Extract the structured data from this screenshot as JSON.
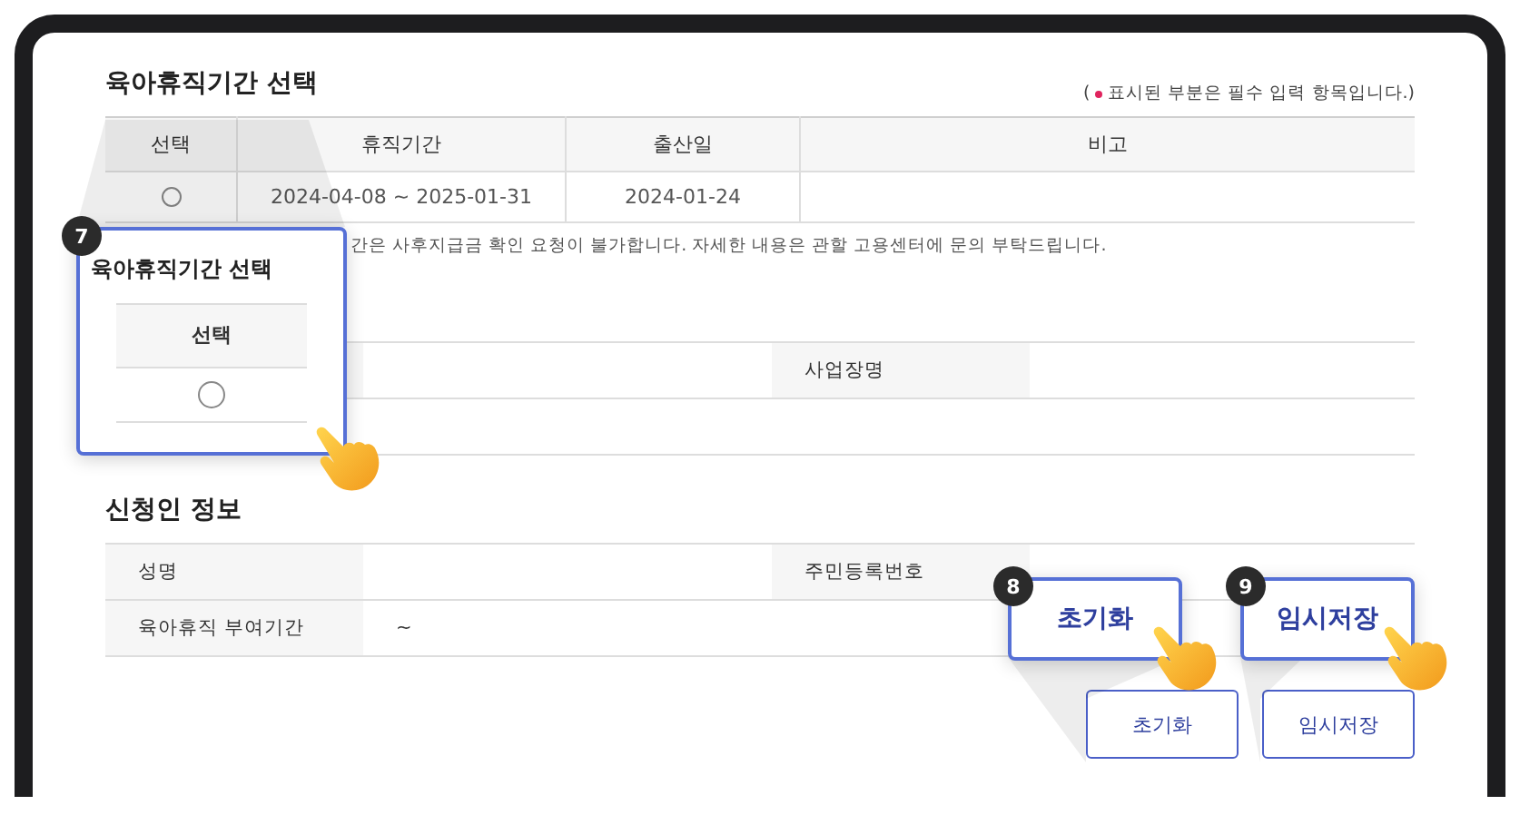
{
  "period_section": {
    "title": "육아휴직기간 선택",
    "required_note": {
      "open": "(",
      "text": "표시된 부분은 필수 입력 항목입니다.)"
    },
    "columns": [
      "선택",
      "휴직기간",
      "출산일",
      "비고"
    ],
    "rows": [
      {
        "cells": [
          {
            "kind": "radio",
            "selected": false
          },
          {
            "kind": "text",
            "text": "2024-04-08 ~ 2025-01-31"
          },
          {
            "kind": "text",
            "text": "2024-01-24"
          },
          {
            "kind": "blank"
          }
        ]
      }
    ],
    "notice": "간은 사후지급금 확인 요청이 불가합니다. 자세한 내용은 관할 고용센터에 문의 부탁드립니다."
  },
  "workplace_table": {
    "rows": [
      {
        "cells": [
          {
            "kind": "label"
          },
          {
            "kind": "value"
          },
          {
            "kind": "label",
            "text": "사업장명"
          },
          {
            "kind": "value"
          }
        ]
      },
      {
        "cells": [
          {
            "kind": "value"
          },
          {
            "kind": "value"
          },
          {
            "kind": "value"
          },
          {
            "kind": "value"
          }
        ]
      }
    ]
  },
  "applicant_section": {
    "title": "신청인 정보",
    "rows": [
      {
        "cells": [
          {
            "kind": "label",
            "text": "성명"
          },
          {
            "kind": "value"
          },
          {
            "kind": "label",
            "text": "주민등록번호"
          },
          {
            "kind": "value"
          }
        ]
      },
      {
        "cells": [
          {
            "kind": "label",
            "text": "육아휴직 부여기간"
          },
          {
            "kind": "value",
            "text": "~"
          },
          {
            "kind": "value"
          },
          {
            "kind": "value"
          }
        ]
      }
    ]
  },
  "buttons": [
    {
      "label": "초기화"
    },
    {
      "label": "임시저장"
    }
  ],
  "callouts": [
    {
      "number": "7",
      "kind": "table",
      "title": "육아휴직기간 선택",
      "column": "선택",
      "selected": false
    },
    {
      "number": "8",
      "kind": "button",
      "label": "초기화"
    },
    {
      "number": "9",
      "kind": "button",
      "label": "임시저장"
    }
  ]
}
